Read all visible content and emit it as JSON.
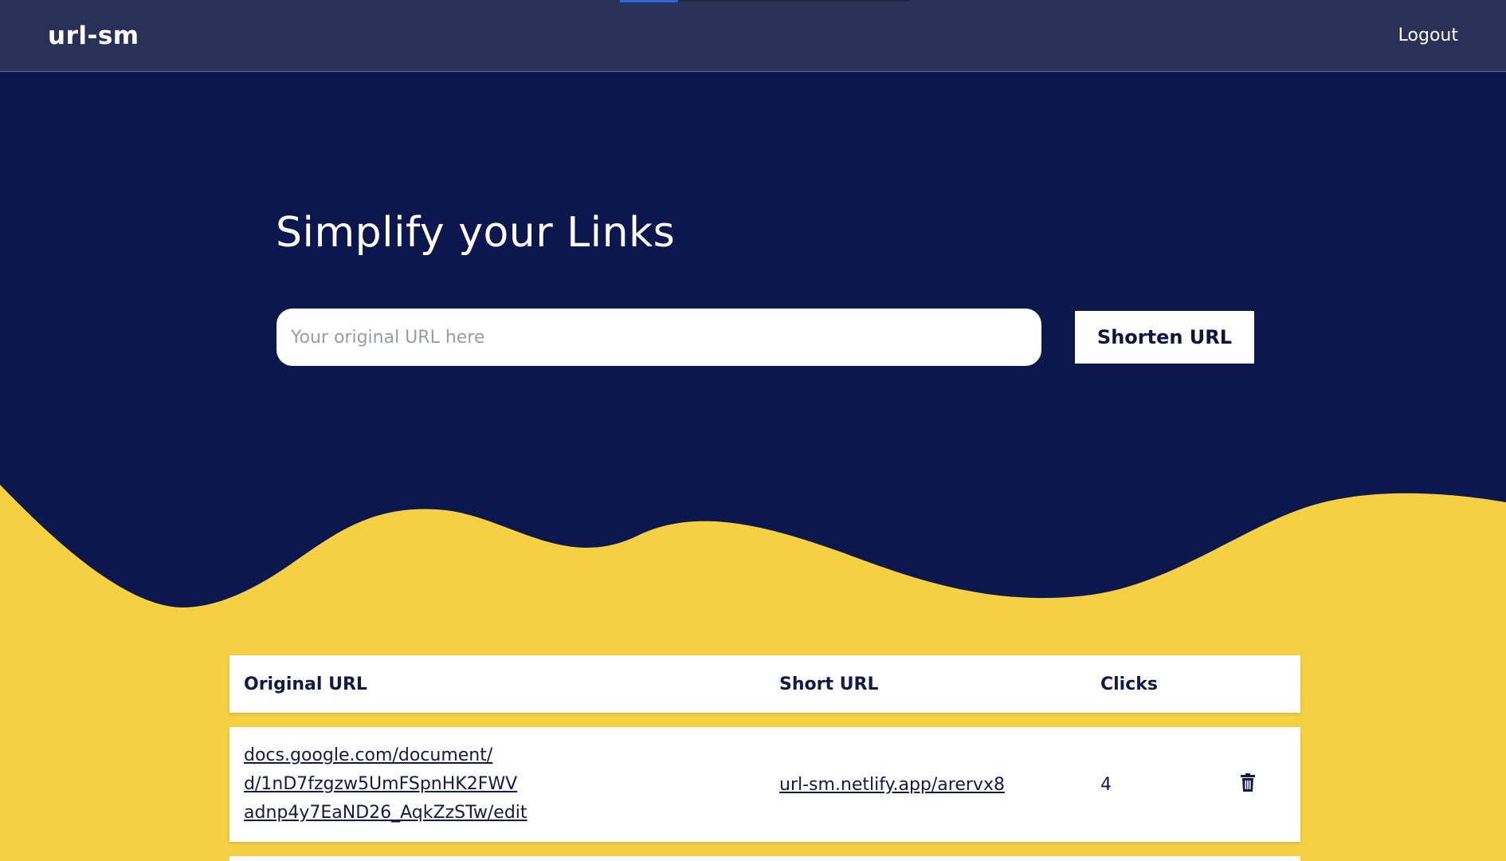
{
  "app": {
    "brand": "url-sm",
    "logout_label": "Logout"
  },
  "hero": {
    "title": "Simplify your Links",
    "input_placeholder": "Your original URL here",
    "input_value": "",
    "button_label": "Shorten URL"
  },
  "colors": {
    "nav_bg": "#293159",
    "hero_bg": "#0b174d",
    "accent_yellow": "#f4d042",
    "text_dark": "#101a45"
  },
  "table": {
    "headers": {
      "original": "Original URL",
      "short": "Short URL",
      "clicks": "Clicks"
    },
    "rows": [
      {
        "original_line1": "docs.google.com/document/",
        "original_line2": "d/1nD7fzgzw5UmFSpnHK2FWV",
        "original_line3": "adnp4y7EaND26_AqkZzSTw/edit",
        "short": "url-sm.netlify.app/arervx8",
        "clicks": "4",
        "delete_icon": "trash-icon"
      }
    ]
  }
}
